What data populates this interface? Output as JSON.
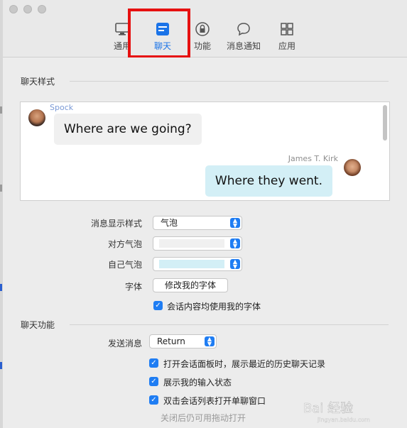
{
  "toolbar": {
    "tabs": [
      {
        "label": "通用",
        "icon": "monitor-icon"
      },
      {
        "label": "聊天",
        "icon": "chat-window-icon",
        "active": true
      },
      {
        "label": "功能",
        "icon": "lock-icon"
      },
      {
        "label": "消息通知",
        "icon": "speech-bubble-icon"
      },
      {
        "label": "应用",
        "icon": "grid-icon"
      }
    ]
  },
  "chat_style": {
    "title": "聊天样式",
    "preview": {
      "incoming": {
        "name": "Spock",
        "text": "Where are we going?"
      },
      "outgoing": {
        "name": "James T. Kirk",
        "text": "Where they went."
      }
    },
    "rows": {
      "display_style_label": "消息显示样式",
      "display_style_value": "气泡",
      "other_bubble_label": "对方气泡",
      "own_bubble_label": "自己气泡",
      "font_label": "字体",
      "font_button": "修改我的字体"
    },
    "use_my_font_label": "会话内容均使用我的字体"
  },
  "chat_features": {
    "title": "聊天功能",
    "send_label": "发送消息",
    "send_value": "Return",
    "options": [
      "打开会话面板时，展示最近的历史聊天记录",
      "展示我的输入状态",
      "双击会话列表打开单聊窗口"
    ],
    "hint": "关闭后仍可用拖动打开"
  },
  "watermark": {
    "text": "Bai 经验",
    "sub": "jingyan.baidu.com"
  },
  "colors": {
    "accent": "#1f7df3",
    "highlight_box": "#e61010",
    "incoming_bubble": "#f0f0f0",
    "outgoing_bubble": "#d3eff6",
    "spock_name": "#7b9ad6",
    "kirk_name": "#8e8e8e"
  }
}
